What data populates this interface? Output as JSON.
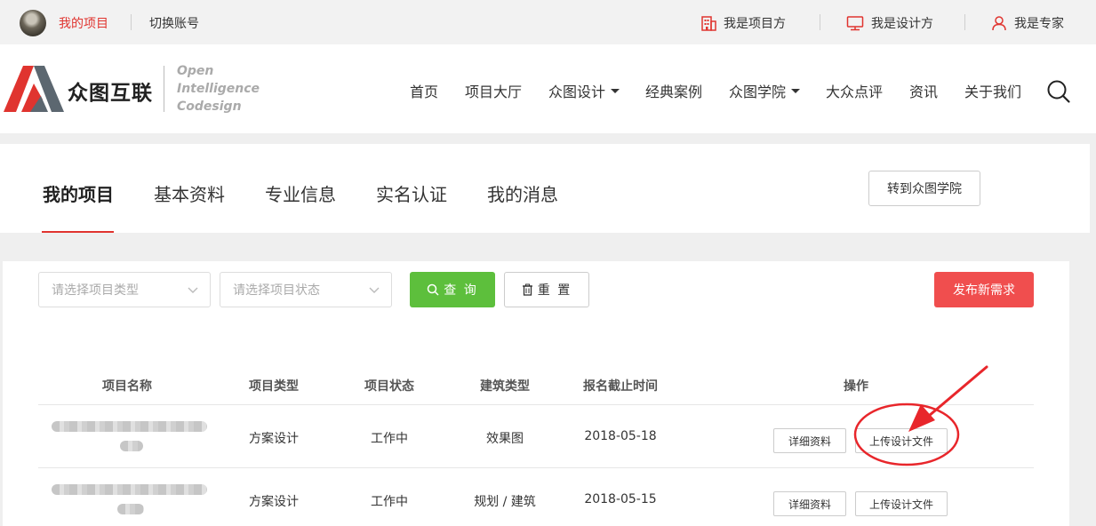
{
  "topbar": {
    "my_projects": "我的项目",
    "switch_account": "切换账号",
    "roles": [
      {
        "label": "我是项目方",
        "icon": "building-icon"
      },
      {
        "label": "我是设计方",
        "icon": "monitor-icon"
      },
      {
        "label": "我是专家",
        "icon": "user-icon"
      }
    ]
  },
  "header": {
    "logo_name": "众图互联",
    "slogan": [
      "Open",
      "Intelligence",
      "Codesign"
    ],
    "nav": [
      {
        "label": "首页"
      },
      {
        "label": "项目大厅"
      },
      {
        "label": "众图设计",
        "dropdown": true
      },
      {
        "label": "经典案例"
      },
      {
        "label": "众图学院",
        "dropdown": true
      },
      {
        "label": "大众点评"
      },
      {
        "label": "资讯"
      },
      {
        "label": "关于我们"
      }
    ]
  },
  "tabs": {
    "items": [
      "我的项目",
      "基本资料",
      "专业信息",
      "实名认证",
      "我的消息"
    ],
    "active": "我的项目",
    "academy_button": "转到众图学院"
  },
  "filters": {
    "type_placeholder": "请选择项目类型",
    "status_placeholder": "请选择项目状态",
    "query_label": "查 询",
    "reset_label": "重 置",
    "publish_label": "发布新需求"
  },
  "table": {
    "headers": [
      "项目名称",
      "项目类型",
      "项目状态",
      "建筑类型",
      "报名截止时间",
      "操作"
    ],
    "rows": [
      {
        "type": "方案设计",
        "status": "工作中",
        "building": "效果图",
        "deadline": "2018-05-18",
        "detail": "详细资料",
        "upload": "上传设计文件"
      },
      {
        "type": "方案设计",
        "status": "工作中",
        "building": "规划 / 建筑",
        "deadline": "2018-05-15",
        "detail": "详细资料",
        "upload": "上传设计文件"
      }
    ]
  },
  "colors": {
    "brand_red": "#e0342f",
    "query_green": "#5dbf3c",
    "publish_red": "#f04e4e",
    "annotation_red": "#e8262b"
  }
}
